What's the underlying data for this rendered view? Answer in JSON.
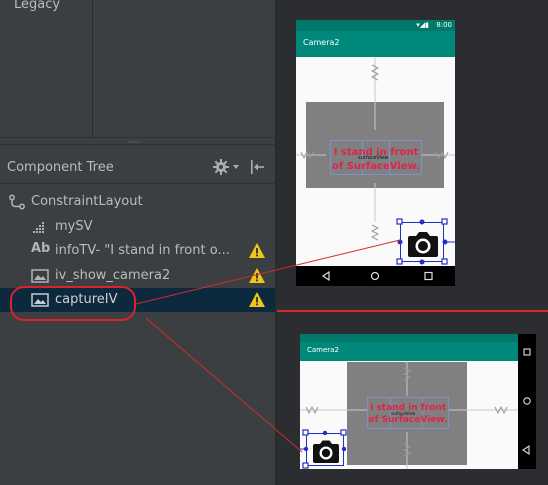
{
  "palette": {
    "category": "Legacy"
  },
  "component_tree": {
    "title": "Component Tree",
    "items": [
      {
        "label": "ConstraintLayout",
        "icon": "constraint-layout-icon",
        "warning": false
      },
      {
        "label": "mySV",
        "icon": "surface-view-icon",
        "warning": false
      },
      {
        "label": "infoTV- \"I stand in front o...",
        "icon": "text-view-icon",
        "icon_text": "Ab",
        "warning": true
      },
      {
        "label": "iv_show_camera2",
        "icon": "image-view-icon",
        "warning": true
      },
      {
        "label": "captureIV",
        "icon": "image-view-icon",
        "warning": true,
        "selected": true
      }
    ]
  },
  "preview_portrait": {
    "app_title": "Camera2",
    "status_time": "8:00",
    "info_text_line1": "I stand in front",
    "info_text_line2": "of SurfaceView.",
    "small_label": "surfaceView"
  },
  "preview_landscape": {
    "app_title": "Camera2",
    "info_text_line1": "I stand in front",
    "info_text_line2": "of SurfaceView.",
    "small_label": "surfaceView"
  },
  "colors": {
    "panel_bg": "#3c3f41",
    "selection": "#0d293e",
    "annotation_red": "#e0202c",
    "app_bar": "#00897b",
    "status_bar": "#00796b",
    "warning_yellow": "#f0c61c",
    "info_text": "#e0234e"
  }
}
